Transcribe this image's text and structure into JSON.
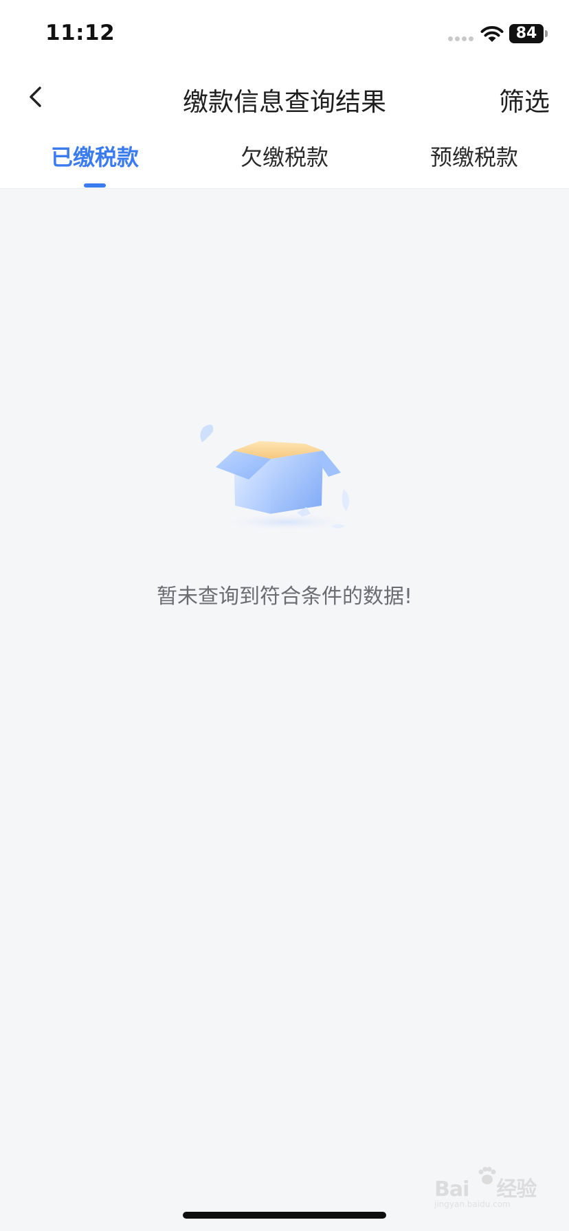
{
  "status_bar": {
    "time": "11:12",
    "battery": "84"
  },
  "nav": {
    "back_icon": "chevron-left-icon",
    "title": "缴款信息查询结果",
    "filter_label": "筛选"
  },
  "tabs": [
    {
      "label": "已缴税款",
      "active": true
    },
    {
      "label": "欠缴税款",
      "active": false
    },
    {
      "label": "预缴税款",
      "active": false
    }
  ],
  "empty_state": {
    "icon": "empty-box-illustration",
    "message": "暂未查询到符合条件的数据!"
  },
  "watermark": {
    "brand": "Bai",
    "brand_suffix": "经验",
    "domain": "jingyan.baidu.com"
  },
  "colors": {
    "accent": "#3a7bf0",
    "background": "#f5f6f8",
    "header": "#ffffff",
    "empty_text": "#6a6c70"
  }
}
